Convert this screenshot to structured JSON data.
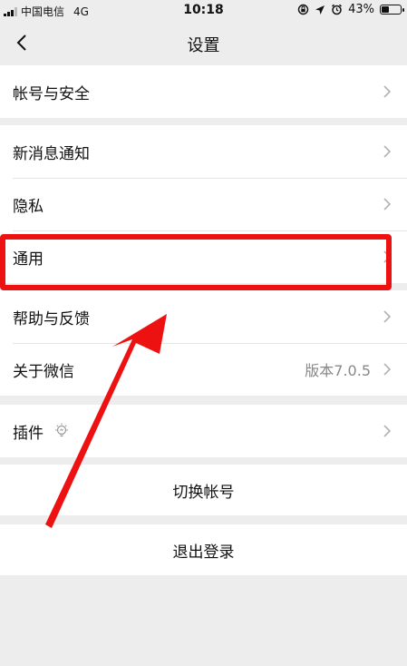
{
  "status_bar": {
    "carrier": "中国电信",
    "network": "4G",
    "time": "10:18",
    "battery": "43%",
    "battery_level": 0.43
  },
  "nav": {
    "title": "设置"
  },
  "groups": [
    {
      "items": [
        {
          "label": "帐号与安全"
        }
      ]
    },
    {
      "items": [
        {
          "label": "新消息通知"
        },
        {
          "label": "隐私"
        },
        {
          "label": "通用"
        }
      ]
    },
    {
      "items": [
        {
          "label": "帮助与反馈"
        },
        {
          "label": "关于微信",
          "value": "版本7.0.5"
        }
      ]
    },
    {
      "items": [
        {
          "label": "插件"
        }
      ]
    }
  ],
  "actions": {
    "switch_account": "切换帐号",
    "logout": "退出登录"
  },
  "colors": {
    "background": "#ededed",
    "annotation": "#ee1111",
    "secondary_text": "#888888"
  }
}
